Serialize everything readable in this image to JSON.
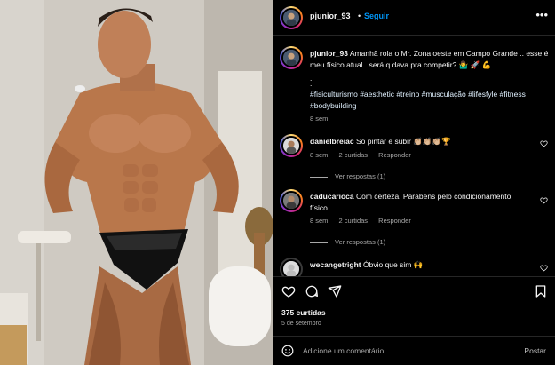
{
  "post": {
    "author": "pjunior_93",
    "dot": "•",
    "follow_label": "Seguir",
    "more_label": "•••",
    "photo_alt": "",
    "caption": {
      "username": "pjunior_93",
      "text": "Amanhã rola o Mr. Zona oeste em Campo Grande .. esse é meu físico atual.. será q dava pra competir? 🤷‍♂️ 🚀 💪",
      "dots": ".\n.\n.",
      "hashtags": "#fisiculturismo #aesthetic #treino #musculação #lifesfyle #fitness #bodybuilding",
      "time": "8 sem"
    }
  },
  "comments": [
    {
      "username": "danielbreiac",
      "text": "Só pintar e subir 👏🏼👏🏼👏🏼🏆",
      "time": "8 sem",
      "likes": "2 curtidas",
      "reply": "Responder",
      "replies": "Ver respostas (1)"
    },
    {
      "username": "caducarioca",
      "text": "Com certeza. Parabéns pelo condicionamento físico.",
      "time": "8 sem",
      "likes": "2 curtidas",
      "reply": "Responder",
      "replies": "Ver respostas (1)"
    },
    {
      "username": "wecangetright",
      "text": "Óbvio que sim 🙌"
    }
  ],
  "footer": {
    "likes": "375 curtidas",
    "date": "5 de setembro",
    "add_comment_placeholder": "Adicione um comentário...",
    "post_label": "Postar"
  },
  "icons": {
    "like": "heart-icon",
    "comment": "comment-icon",
    "share": "share-icon",
    "save": "bookmark-icon",
    "emoji": "emoji-icon",
    "more": "more-options-icon"
  },
  "colors": {
    "background": "#000000",
    "link_blue": "#0095f6",
    "hashtag": "#e0f1ff",
    "muted": "#a8a8a8",
    "divider": "#262626"
  }
}
